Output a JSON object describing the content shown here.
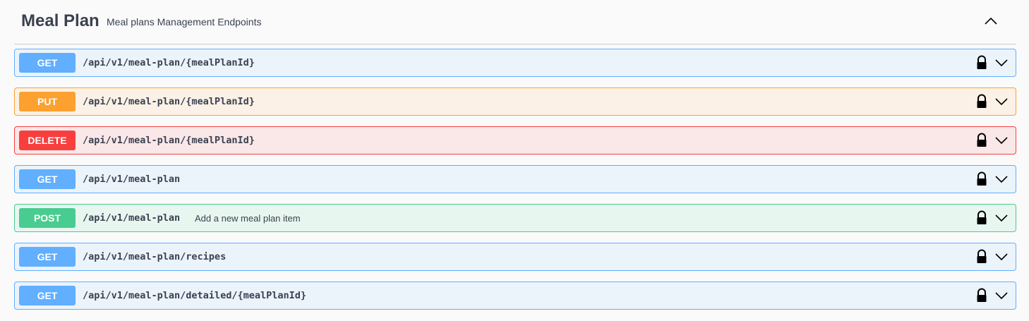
{
  "tag": {
    "title": "Meal Plan",
    "description": "Meal plans Management Endpoints"
  },
  "operations": [
    {
      "method": "GET",
      "path": "/api/v1/meal-plan/{mealPlanId}",
      "summary": ""
    },
    {
      "method": "PUT",
      "path": "/api/v1/meal-plan/{mealPlanId}",
      "summary": ""
    },
    {
      "method": "DELETE",
      "path": "/api/v1/meal-plan/{mealPlanId}",
      "summary": ""
    },
    {
      "method": "GET",
      "path": "/api/v1/meal-plan",
      "summary": ""
    },
    {
      "method": "POST",
      "path": "/api/v1/meal-plan",
      "summary": "Add a new meal plan item"
    },
    {
      "method": "GET",
      "path": "/api/v1/meal-plan/recipes",
      "summary": ""
    },
    {
      "method": "GET",
      "path": "/api/v1/meal-plan/detailed/{mealPlanId}",
      "summary": ""
    }
  ],
  "icons": {
    "collapse": "chevron-up-icon",
    "lock": "lock-icon",
    "expand": "chevron-down-icon"
  },
  "colors": {
    "get": "#61affe",
    "put": "#fca130",
    "delete": "#f93e3e",
    "post": "#49cc90"
  }
}
